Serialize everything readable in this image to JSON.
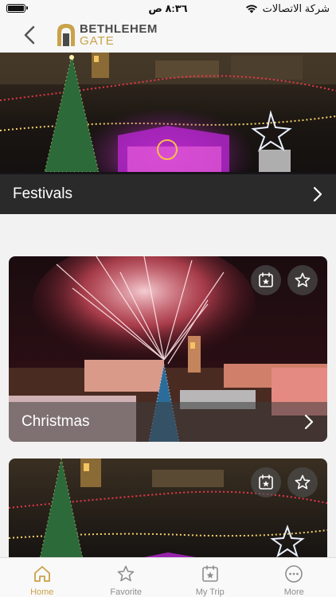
{
  "status_bar": {
    "time": "٨:٣٦ ص",
    "carrier": "شركة الاتصالات"
  },
  "header": {
    "logo_line1": "BETHLEHEM",
    "logo_line2": "GATE"
  },
  "banner": {
    "label": "Festivals"
  },
  "cards": [
    {
      "label": "Christmas"
    },
    {
      "label": ""
    }
  ],
  "tabs": [
    {
      "label": "Home",
      "icon": "home-icon",
      "active": true
    },
    {
      "label": "Favorite",
      "icon": "star-icon",
      "active": false
    },
    {
      "label": "My Trip",
      "icon": "calendar-star-icon",
      "active": false
    },
    {
      "label": "More",
      "icon": "more-icon",
      "active": false
    }
  ],
  "colors": {
    "accent": "#c9a24a",
    "inactive": "#8e8e8e"
  }
}
